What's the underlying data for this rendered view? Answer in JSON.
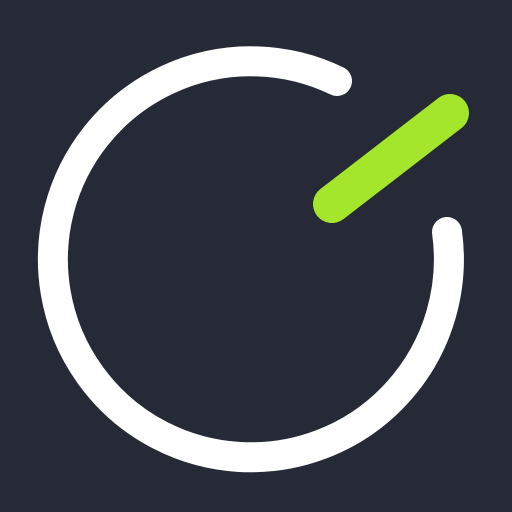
{
  "icon": {
    "name": "timer-logo-icon",
    "background_color": "#262936",
    "ring_color": "#FFFFFF",
    "hand_color": "#A3E62B"
  }
}
